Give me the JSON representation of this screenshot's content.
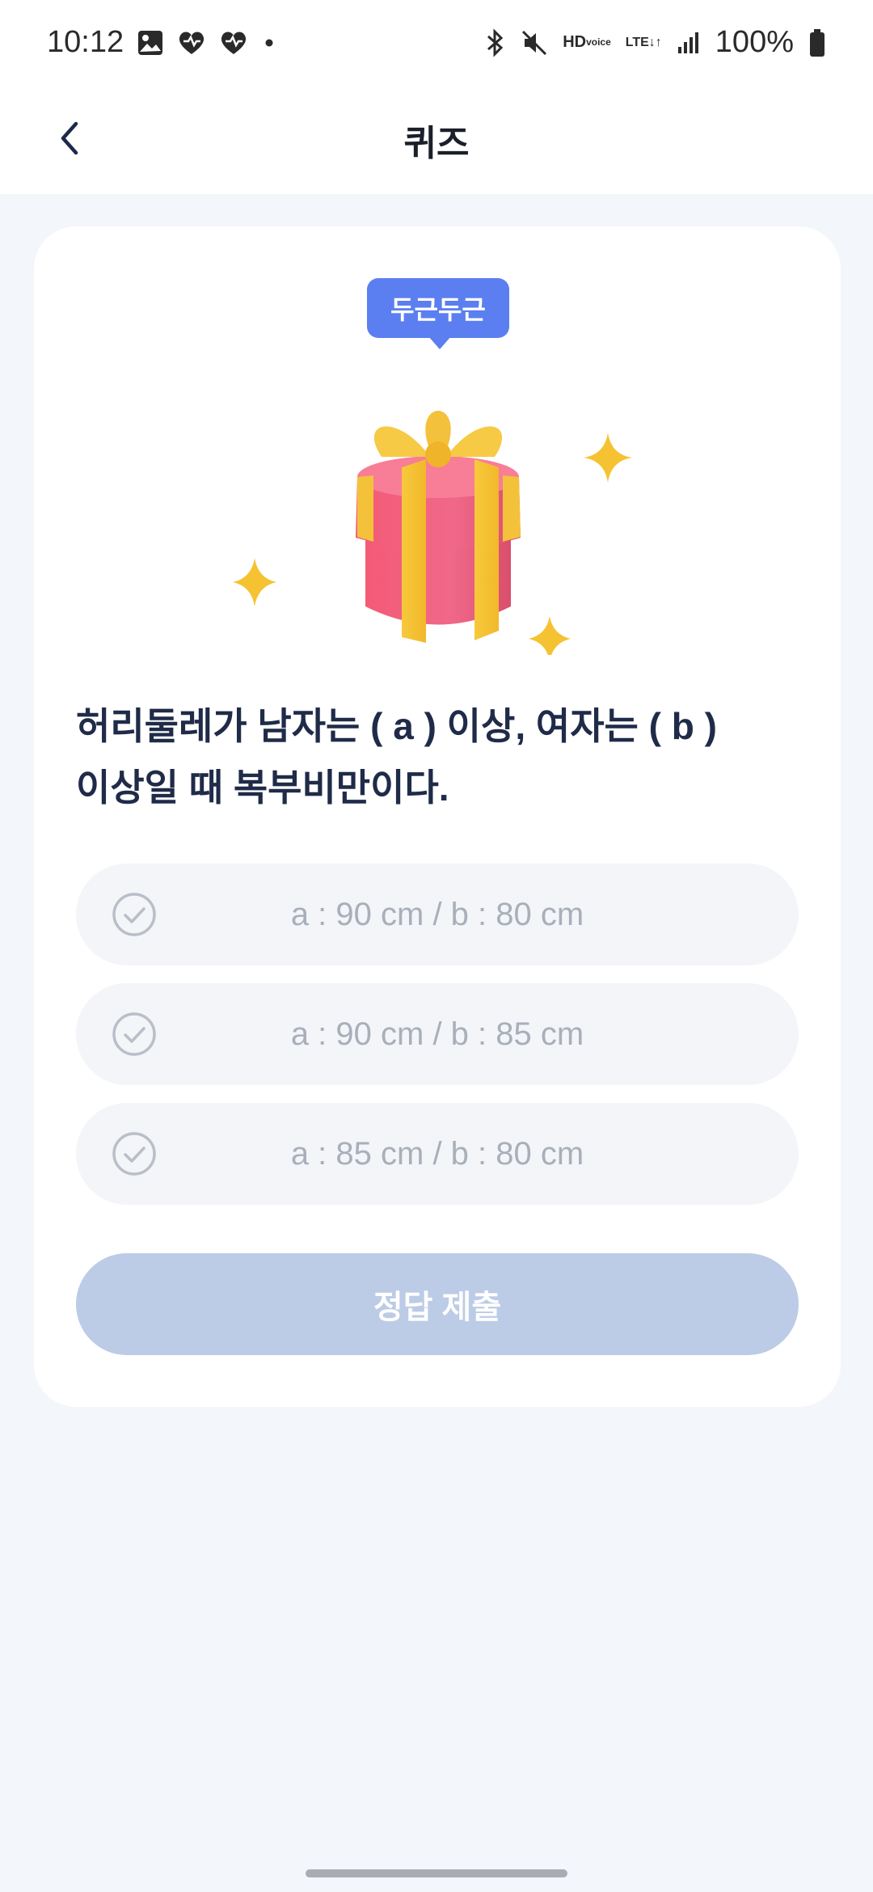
{
  "status_bar": {
    "time": "10:12",
    "hd_line1": "HD",
    "hd_line2": "voice",
    "lte": "LTE",
    "battery": "100%"
  },
  "header": {
    "title": "퀴즈"
  },
  "quiz": {
    "badge": "두근두근",
    "question_line1": "허리둘레가 남자는 ( a ) 이상, 여자는 ( b )",
    "question_line2": "이상일 때 복부비만이다.",
    "options": [
      {
        "label": "a : 90 cm / b : 80 cm"
      },
      {
        "label": "a : 90 cm / b : 85 cm"
      },
      {
        "label": "a : 85 cm / b : 80 cm"
      }
    ],
    "submit_label": "정답 제출"
  },
  "colors": {
    "accent": "#5b7ff0",
    "submit_disabled": "#bccbe6",
    "background": "#f3f6fa"
  },
  "icons": [
    "back-icon",
    "gallery-icon",
    "heart-icon",
    "bluetooth-icon",
    "mute-icon",
    "signal-icon",
    "battery-icon",
    "check-circle-icon"
  ]
}
